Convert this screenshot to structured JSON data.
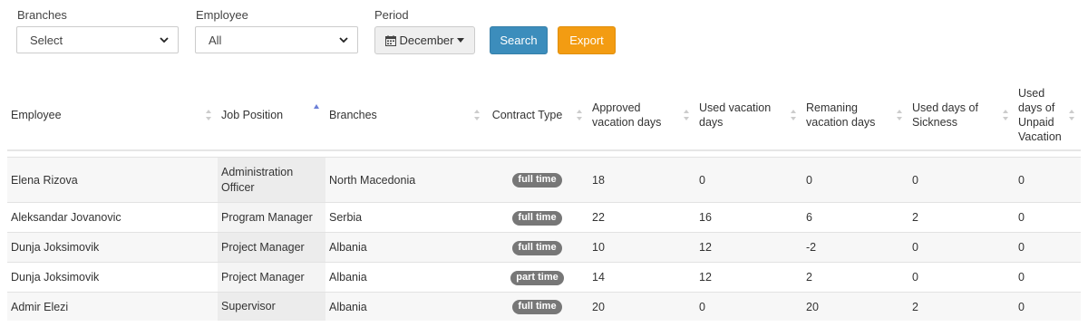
{
  "filters": {
    "branches": {
      "label": "Branches",
      "value": "Select"
    },
    "employee": {
      "label": "Employee",
      "value": "All"
    },
    "period": {
      "label": "Period",
      "value": "December"
    },
    "search_label": "Search",
    "export_label": "Export"
  },
  "table": {
    "columns": [
      "Employee",
      "Job Position",
      "Branches",
      "Contract Type",
      "Approved vacation days",
      "Used vacation days",
      "Remaning vacation days",
      "Used days of Sickness",
      "Used days of Unpaid Vacation"
    ],
    "sorted_column": "Job Position",
    "rows": [
      {
        "employee": "Elena Rizova",
        "job_position": "Administration Officer",
        "branch": "North Macedonia",
        "contract": "full time",
        "approved": "18",
        "used": "0",
        "remaining": "0",
        "sickness": "0",
        "unpaid": "0"
      },
      {
        "employee": "Aleksandar Jovanovic",
        "job_position": "Program Manager",
        "branch": "Serbia",
        "contract": "full time",
        "approved": "22",
        "used": "16",
        "remaining": "6",
        "sickness": "2",
        "unpaid": "0"
      },
      {
        "employee": "Dunja Joksimovik",
        "job_position": "Project Manager",
        "branch": "Albania",
        "contract": "full time",
        "approved": "10",
        "used": "12",
        "remaining": "-2",
        "sickness": "0",
        "unpaid": "0"
      },
      {
        "employee": "Dunja Joksimovik",
        "job_position": "Project Manager",
        "branch": "Albania",
        "contract": "part time",
        "approved": "14",
        "used": "12",
        "remaining": "2",
        "sickness": "0",
        "unpaid": "0"
      },
      {
        "employee": "Admir Elezi",
        "job_position": "Supervisor",
        "branch": "Albania",
        "contract": "full time",
        "approved": "20",
        "used": "0",
        "remaining": "20",
        "sickness": "2",
        "unpaid": "0"
      }
    ]
  },
  "colors": {
    "primary": "#3c8dbc",
    "warning": "#f39c12",
    "badge": "#777777"
  },
  "icons": {
    "period": "calendar-icon",
    "select": "chevron-down-icon",
    "sort": "sort-arrows-icon"
  }
}
